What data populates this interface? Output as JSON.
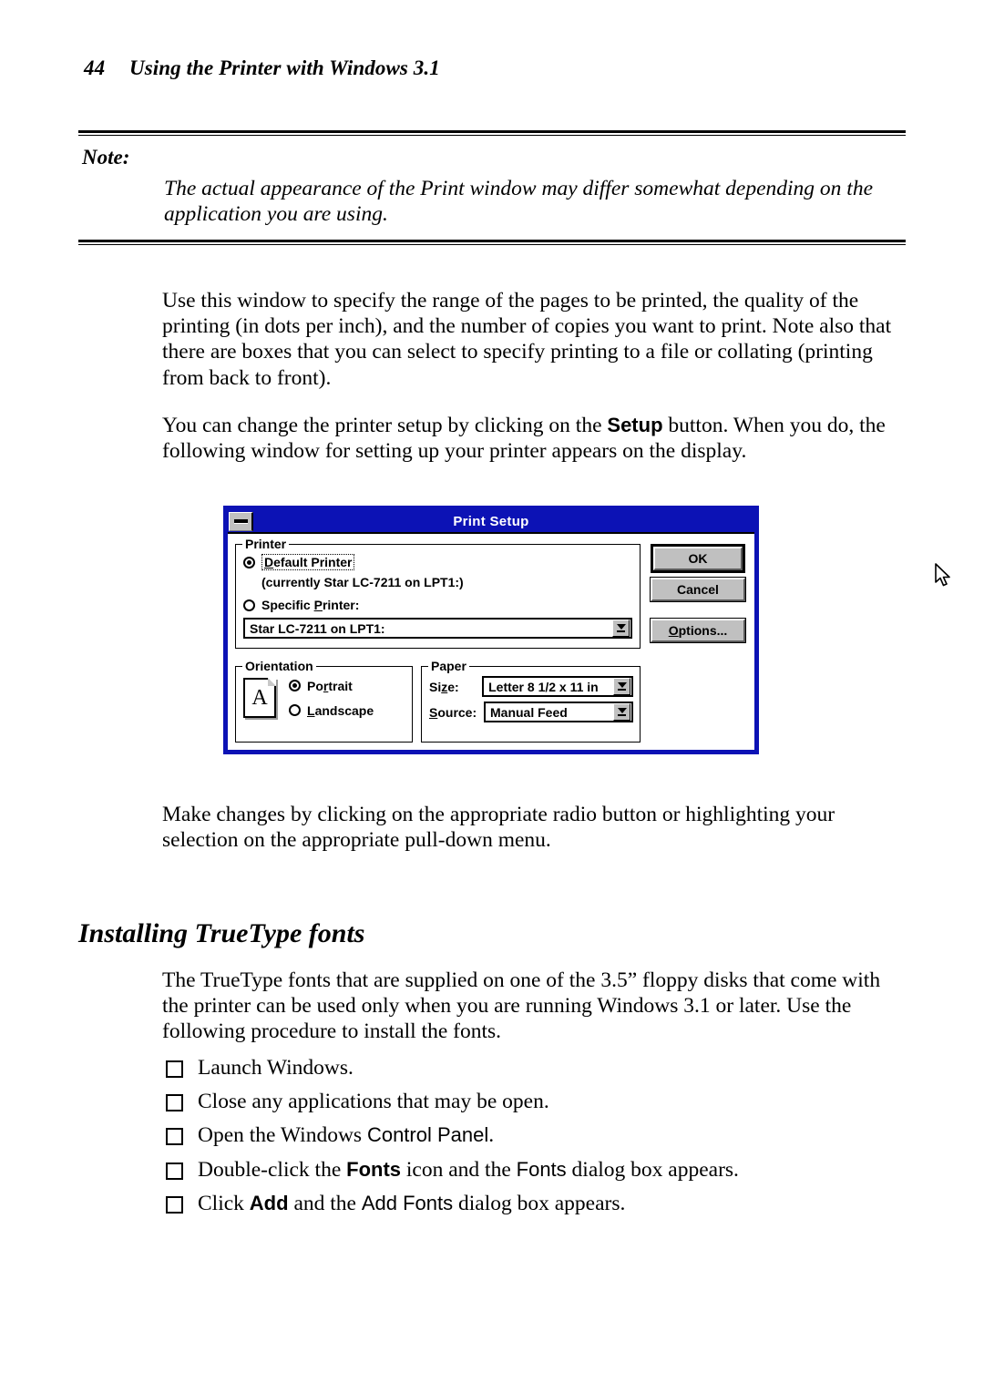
{
  "header": {
    "folio": "44",
    "title": "Using the Printer with Windows 3.1"
  },
  "note": {
    "label": "Note:",
    "text": "The actual appearance of the Print window may differ somewhat depending on the application you are using."
  },
  "body": {
    "para1": "Use this window to specify the range of the pages to be printed, the quality of the printing (in dots per inch), and the number of copies you want to print. Note also that there are boxes that you can select to specify printing to a file or collating (printing from back to front).",
    "para2_a": "You can change the printer setup by clicking on the ",
    "para2_bold": "Setup",
    "para2_b": " button. When you do, the following window for setting up your printer appears on the display.",
    "para3": "Make changes by clicking on the appropriate radio button or highlighting your selection on the appropriate pull-down menu."
  },
  "dialog": {
    "title": "Print Setup",
    "sysmenu_icon": "minimize-box-icon",
    "printer_group": {
      "label": "Printer",
      "default_printer_label": "Default Printer",
      "default_printer_accel": "D",
      "default_printer_selected": true,
      "currently_text": "(currently Star LC-7211 on LPT1:)",
      "specific_printer_label": "Specific Printer:",
      "specific_printer_accel": "P",
      "specific_printer_selected": false,
      "specific_printer_value": "Star LC-7211 on LPT1:"
    },
    "orientation_group": {
      "label": "Orientation",
      "icon": "page-with-letter-a-icon",
      "icon_letter": "A",
      "portrait_label": "Portrait",
      "portrait_accel": "r",
      "portrait_selected": true,
      "landscape_label": "Landscape",
      "landscape_accel": "L",
      "landscape_selected": false
    },
    "paper_group": {
      "label": "Paper",
      "size_label": "Size:",
      "size_accel": "z",
      "size_value": "Letter 8 1/2 x 11 in",
      "source_label": "Source:",
      "source_accel": "S",
      "source_value": "Manual Feed"
    },
    "buttons": {
      "ok": "OK",
      "cancel": "Cancel",
      "options": "Options...",
      "options_accel": "O"
    },
    "cursor_icon": "mouse-arrow-cursor",
    "colors": {
      "titlebar": "#0c12b5",
      "face": "#c0c0c0",
      "title_text": "#ffffff"
    }
  },
  "section": {
    "heading": "Installing TrueType fonts",
    "intro": "The TrueType fonts that are supplied on one of the 3.5” floppy disks that come with the printer can be used only when you are running Windows 3.1 or later. Use the following procedure to install the fonts.",
    "steps": [
      {
        "parts": [
          {
            "t": "Launch Windows.",
            "s": "serif"
          }
        ]
      },
      {
        "parts": [
          {
            "t": "Close any applications that may be open.",
            "s": "serif"
          }
        ]
      },
      {
        "parts": [
          {
            "t": "Open the Windows ",
            "s": "serif"
          },
          {
            "t": "Control Panel",
            "s": "sans"
          },
          {
            "t": ".",
            "s": "serif"
          }
        ]
      },
      {
        "parts": [
          {
            "t": "Double-click the ",
            "s": "serif"
          },
          {
            "t": "Fonts",
            "s": "sans-bold"
          },
          {
            "t": " icon and the ",
            "s": "serif"
          },
          {
            "t": "Fonts",
            "s": "sans"
          },
          {
            "t": " dialog box appears.",
            "s": "serif"
          }
        ]
      },
      {
        "parts": [
          {
            "t": "Click ",
            "s": "serif"
          },
          {
            "t": "Add",
            "s": "sans-bold"
          },
          {
            "t": " and the ",
            "s": "serif"
          },
          {
            "t": "Add Fonts",
            "s": "sans"
          },
          {
            "t": " dialog box appears.",
            "s": "serif"
          }
        ]
      }
    ]
  }
}
